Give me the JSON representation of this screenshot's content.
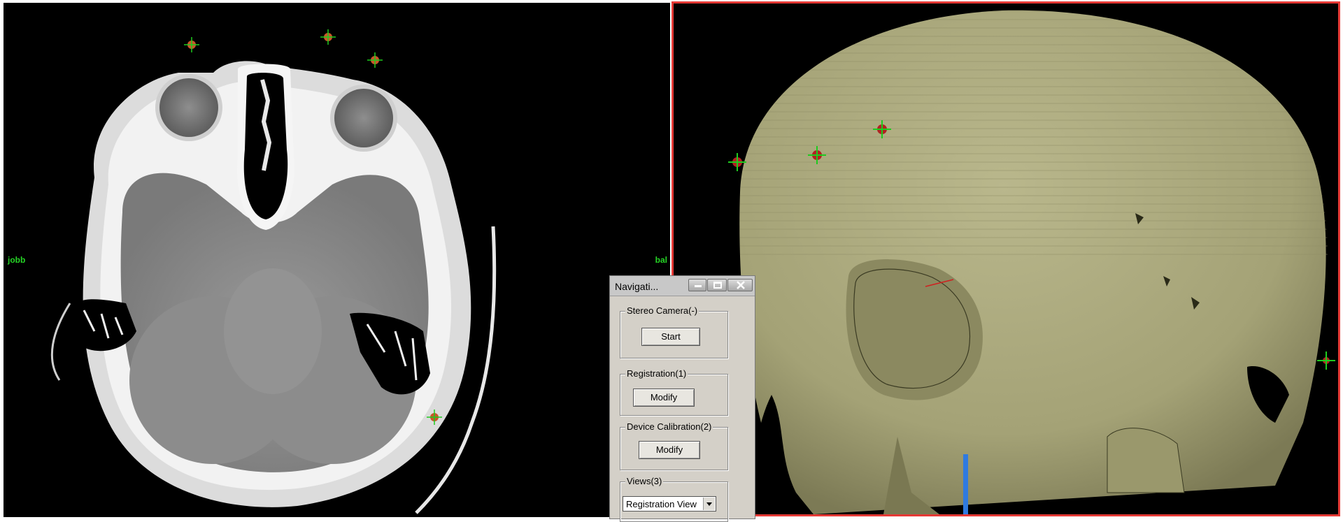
{
  "viewports": {
    "left": {
      "orient_left": "jobb",
      "orient_right": "bal"
    }
  },
  "colors": {
    "marker_green": "#1ecb1e",
    "marker_red": "#c62828",
    "active_border": "#e53935",
    "skull": "#a9a77a",
    "probe": "#2f7ae0"
  },
  "nav": {
    "title": "Navigati...",
    "stereo": {
      "label": "Stereo Camera(-)",
      "button": "Start"
    },
    "registration": {
      "label": "Registration(1)",
      "button": "Modify"
    },
    "calibration": {
      "label": "Device Calibration(2)",
      "button": "Modify"
    },
    "views": {
      "label": "Views(3)",
      "selected": "Registration View"
    }
  }
}
